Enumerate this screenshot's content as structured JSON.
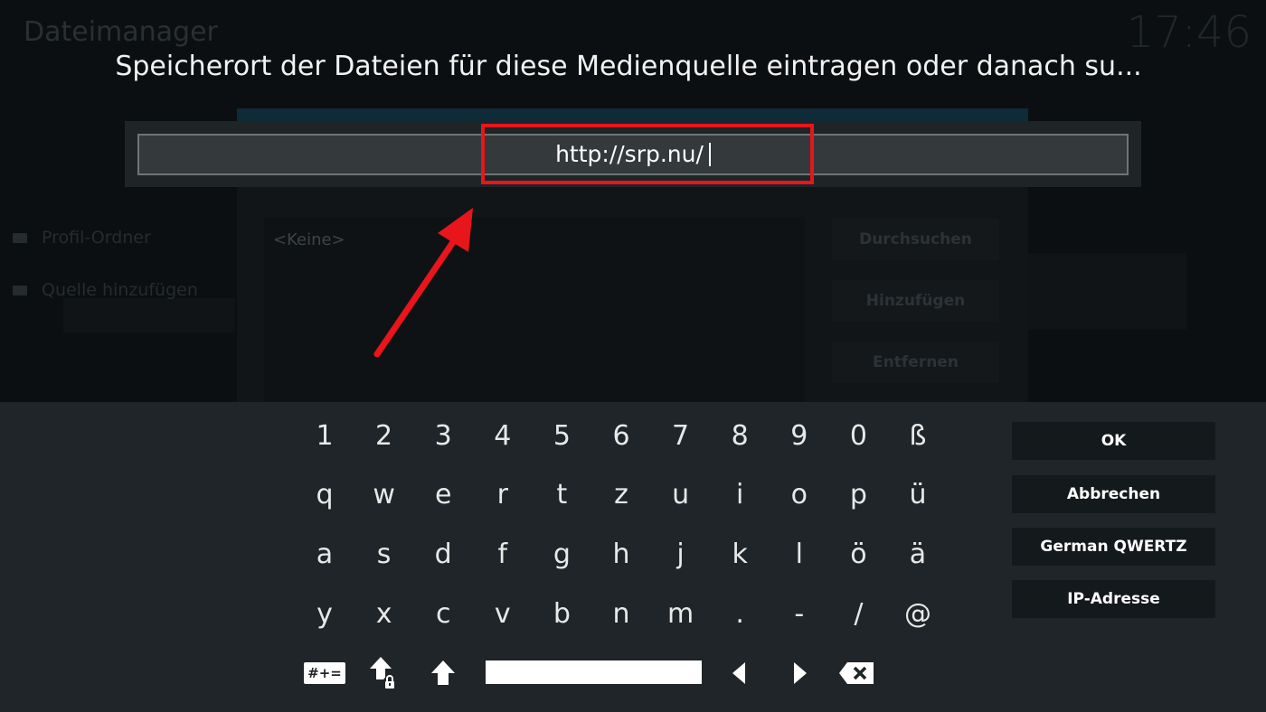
{
  "background": {
    "title": "Dateimanager",
    "clock": "17:46",
    "sidebar": [
      "Profil-Ordner",
      "Quelle hinzufügen"
    ],
    "dialog": {
      "empty_label": "<Keine>",
      "buttons": [
        "Durchsuchen",
        "Hinzufügen",
        "Entfernen"
      ]
    }
  },
  "prompt": {
    "heading": "Speicherort der Dateien für diese Medienquelle eintragen oder danach su...",
    "input_value": "http://srp.nu/"
  },
  "keyboard": {
    "rows": [
      [
        "1",
        "2",
        "3",
        "4",
        "5",
        "6",
        "7",
        "8",
        "9",
        "0",
        "ß"
      ],
      [
        "q",
        "w",
        "e",
        "r",
        "t",
        "z",
        "u",
        "i",
        "o",
        "p",
        "ü"
      ],
      [
        "a",
        "s",
        "d",
        "f",
        "g",
        "h",
        "j",
        "k",
        "l",
        "ö",
        "ä"
      ],
      [
        "y",
        "x",
        "c",
        "v",
        "b",
        "n",
        "m",
        ".",
        "-",
        "/",
        "@"
      ]
    ],
    "symbols_key": "#+=",
    "side_buttons": {
      "ok": "OK",
      "cancel": "Abbrechen",
      "layout": "German QWERTZ",
      "ip": "IP-Adresse"
    }
  },
  "colors": {
    "highlight": "#e8151b",
    "keyboard_bg": "#1f2528",
    "input_bg": "#34393c"
  }
}
